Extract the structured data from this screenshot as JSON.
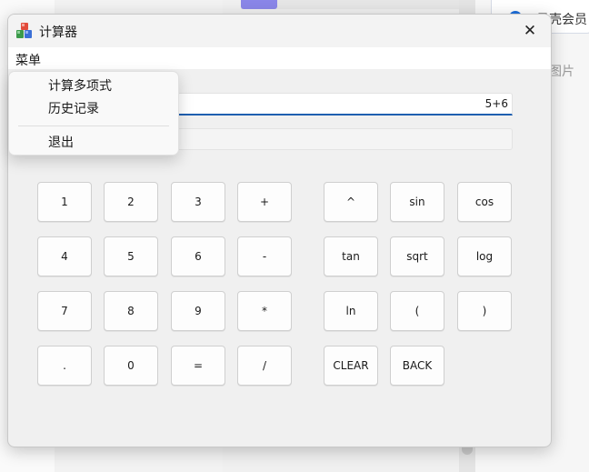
{
  "background": {
    "right_card_text": "贝壳会员",
    "right_side_text": "图片"
  },
  "window": {
    "title": "计算器",
    "app_icon": "calculator-blocks-icon",
    "close_glyph": "✕",
    "menubar": {
      "menu_label": "菜单"
    },
    "expression": "5+6",
    "result": "",
    "buttons": {
      "b1": "1",
      "b2": "2",
      "b3": "3",
      "plus": "+",
      "caret": "^",
      "sin": "sin",
      "cos": "cos",
      "b4": "4",
      "b5": "5",
      "b6": "6",
      "minus": "-",
      "tan": "tan",
      "sqrt": "sqrt",
      "log": "log",
      "b7": "7",
      "b8": "8",
      "b9": "9",
      "multiply": "*",
      "ln": "ln",
      "lparen": "(",
      "rparen": ")",
      "dot": ".",
      "b0": "0",
      "equals": "=",
      "divide": "/",
      "clear": "CLEAR",
      "back": "BACK"
    }
  },
  "dropdown": {
    "items": [
      {
        "label": "计算多项式"
      },
      {
        "label": "历史记录"
      },
      {
        "label": "退出"
      }
    ]
  },
  "colors": {
    "accent": "#1f5fb0",
    "window_bg": "#f0f0f0",
    "button_bg": "#fdfdfd"
  }
}
